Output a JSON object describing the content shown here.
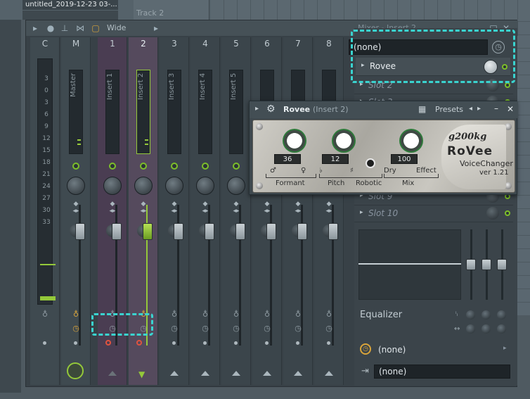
{
  "header": {
    "project_name": "untitled_2019-12-23 03-...",
    "track_label": "Track 2"
  },
  "mixer": {
    "view_label": "Wide",
    "insert_title": "Mixer - Insert 2",
    "channels": [
      {
        "num": "C",
        "label": ""
      },
      {
        "num": "M",
        "label": "Master"
      },
      {
        "num": "1",
        "label": "Insert 1"
      },
      {
        "num": "2",
        "label": "Insert 2"
      },
      {
        "num": "3",
        "label": "Insert 3"
      },
      {
        "num": "4",
        "label": "Insert 4"
      },
      {
        "num": "5",
        "label": "Insert 5"
      },
      {
        "num": "6",
        "label": ""
      },
      {
        "num": "7",
        "label": ""
      },
      {
        "num": "8",
        "label": ""
      }
    ],
    "meter_scale": [
      "3",
      "0",
      "3",
      "6",
      "9",
      "12",
      "15",
      "18",
      "21",
      "24",
      "27",
      "30",
      "33"
    ]
  },
  "insert_panel": {
    "input": "(none)",
    "active_slot": "Rovee",
    "slots": [
      "Slot 2",
      "Slot 3",
      "Slot 9",
      "Slot 10"
    ],
    "eq_label": "Equalizer",
    "send": "(none)",
    "output": "(none)"
  },
  "plugin": {
    "title": "Rovee",
    "title_suffix": "(Insert 2)",
    "presets_label": "Presets",
    "formant_value": "36",
    "pitch_value": "12",
    "mix_value": "100",
    "formant_label": "Formant",
    "pitch_label": "Pitch",
    "robotic_label": "Robotic",
    "mix_label": "Mix",
    "dry_label": "Dry",
    "effect_label": "Effect",
    "male_symbol": "♂",
    "female_symbol": "♀",
    "flat_symbol": "♭",
    "sharp_symbol": "♯",
    "brand": "g200kg",
    "product": "RoVee",
    "subtitle": "VoiceChanger",
    "version": "ver 1.21"
  },
  "colors": {
    "accent_green": "#94c83a",
    "highlight": "#3ad3cf",
    "record_red": "#e0533f"
  }
}
